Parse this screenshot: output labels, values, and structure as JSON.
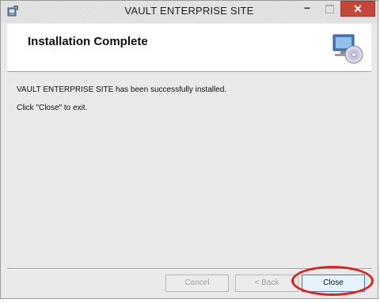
{
  "window": {
    "title": "VAULT ENTERPRISE SITE",
    "app_icon": "installer-icon",
    "controls": {
      "minimize": "−",
      "maximize_icon": "maximize-icon",
      "close": "✕"
    }
  },
  "header": {
    "title": "Installation Complete",
    "icon": "computer-disc-icon"
  },
  "content": {
    "message": "VAULT ENTERPRISE SITE has been successfully installed.",
    "instruction": "Click \"Close\" to exit."
  },
  "buttons": {
    "cancel": "Cancel",
    "back": "< Back",
    "close": "Close"
  },
  "colors": {
    "close_button_bg": "#c7463a",
    "highlight": "#e0201e",
    "default_button_border": "#3c7fb1"
  }
}
